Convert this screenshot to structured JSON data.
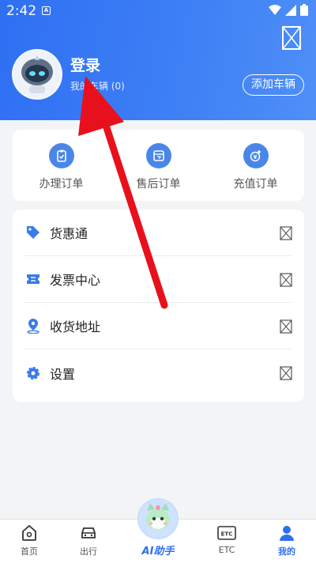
{
  "status_bar": {
    "time": "2:42",
    "notification_letter": "A"
  },
  "profile": {
    "login_label": "登录",
    "vehicles_label": "我的车辆 (0)",
    "add_vehicle_button": "添加车辆"
  },
  "orders": [
    {
      "label": "办理订单",
      "icon": "clipboard-icon"
    },
    {
      "label": "售后订单",
      "icon": "after-sales-icon"
    },
    {
      "label": "充值订单",
      "icon": "yuan-coin-icon"
    }
  ],
  "menu": [
    {
      "label": "货惠通",
      "icon": "tag-icon"
    },
    {
      "label": "发票中心",
      "icon": "ticket-icon"
    },
    {
      "label": "收货地址",
      "icon": "location-pin-icon"
    },
    {
      "label": "设置",
      "icon": "gear-icon"
    }
  ],
  "bottom_nav": {
    "home": "首页",
    "travel": "出行",
    "ai": "AI助手",
    "etc": "ETC",
    "etc_icon_text": "ETC",
    "mine": "我的"
  },
  "colors": {
    "brand_blue": "#2f6ff3",
    "annotation_red": "#e8101c"
  }
}
